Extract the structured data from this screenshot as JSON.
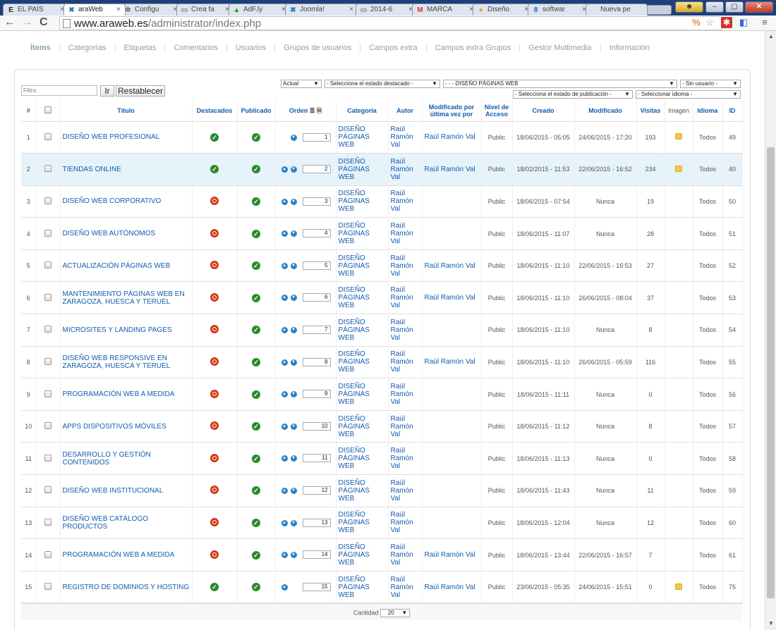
{
  "browser": {
    "tabs": [
      {
        "label": "EL PAÍS",
        "icon": "E"
      },
      {
        "label": "araWeb",
        "icon": "X"
      },
      {
        "label": "Configu",
        "icon": "gear"
      },
      {
        "label": "Crea fa",
        "icon": "page"
      },
      {
        "label": "AdF.ly",
        "icon": "ad"
      },
      {
        "label": "Joomla!",
        "icon": "X"
      },
      {
        "label": "2014-6",
        "icon": "page"
      },
      {
        "label": "MARCA",
        "icon": "M"
      },
      {
        "label": "Diseño",
        "icon": "circle"
      },
      {
        "label": "softwar",
        "icon": "8"
      },
      {
        "label": "Nueva pe",
        "icon": "none"
      }
    ],
    "url_host": "www.araweb.es",
    "url_path": "/administrator/index.php"
  },
  "subnav": [
    "Ítems",
    "Categorías",
    "Etiquetas",
    "Comentarios",
    "Usuarios",
    "Grupos de usuarios",
    "Campos extra",
    "Campos extra Grupos",
    "Gestor Multimedia",
    "Información"
  ],
  "filters": {
    "filter_placeholder": "Filtro:",
    "go_label": "Ir",
    "reset_label": "Restablecer",
    "actual": "Actual",
    "featured_state": "- Selecciona el estado destacado -",
    "category": "- - - DISEÑO PÁGINAS WEB",
    "user": "- Sin usuario -",
    "publish_state": "- Selecciona el estado de publicación -",
    "language": "- Seleccionar idioma -"
  },
  "columns": {
    "num": "#",
    "title": "Título",
    "featured": "Destacados",
    "published": "Publicado",
    "order": "Orden",
    "category": "Categoría",
    "author": "Autor",
    "modified_by": "Modificado por última vez por",
    "access": "Nivel de Acceso",
    "created": "Creado",
    "modified": "Modificado",
    "hits": "Visitas",
    "image": "Imagen",
    "language": "Idioma",
    "id": "ID"
  },
  "rows": [
    {
      "num": "1",
      "title": "DISEÑO WEB PROFESIONAL",
      "featured": true,
      "published": true,
      "up": false,
      "down": true,
      "order": "1",
      "category": "DISEÑO PÁGINAS WEB",
      "author": "Raúl Ramón Val",
      "modified_by": "Raúl Ramón Val",
      "access": "Public",
      "created": "18/06/2015 - 05:05",
      "modified": "24/06/2015 - 17:20",
      "hits": "193",
      "image": true,
      "language": "Todos",
      "id": "49"
    },
    {
      "num": "2",
      "title": "TIENDAS ONLINE",
      "featured": true,
      "published": true,
      "up": true,
      "down": true,
      "order": "2",
      "category": "DISEÑO PÁGINAS WEB",
      "author": "Raúl Ramón Val",
      "modified_by": "Raúl Ramón Val",
      "access": "Public",
      "created": "18/02/2015 - 11:53",
      "modified": "22/06/2015 - 16:52",
      "hits": "234",
      "image": true,
      "language": "Todos",
      "id": "40"
    },
    {
      "num": "3",
      "title": "DISEÑO WEB CORPORATIVO",
      "featured": false,
      "published": true,
      "up": true,
      "down": true,
      "order": "3",
      "category": "DISEÑO PÁGINAS WEB",
      "author": "Raúl Ramón Val",
      "modified_by": "",
      "access": "Public",
      "created": "18/06/2015 - 07:54",
      "modified": "Nunca",
      "hits": "19",
      "image": false,
      "language": "Todos",
      "id": "50"
    },
    {
      "num": "4",
      "title": "DISEÑO WEB AUTÓNOMOS",
      "featured": false,
      "published": true,
      "up": true,
      "down": true,
      "order": "4",
      "category": "DISEÑO PÁGINAS WEB",
      "author": "Raúl Ramón Val",
      "modified_by": "",
      "access": "Public",
      "created": "18/06/2015 - 11:07",
      "modified": "Nunca",
      "hits": "28",
      "image": false,
      "language": "Todos",
      "id": "51"
    },
    {
      "num": "5",
      "title": "ACTUALIZACIÓN PÁGINAS WEB",
      "featured": false,
      "published": true,
      "up": true,
      "down": true,
      "order": "5",
      "category": "DISEÑO PÁGINAS WEB",
      "author": "Raúl Ramón Val",
      "modified_by": "Raúl Ramón Val",
      "access": "Public",
      "created": "18/06/2015 - 11:10",
      "modified": "22/06/2015 - 16:53",
      "hits": "27",
      "image": false,
      "language": "Todos",
      "id": "52"
    },
    {
      "num": "6",
      "title": "MANTENIMIENTO PÁGINAS WEB EN ZARAGOZA, HUESCA Y TERUEL",
      "featured": false,
      "published": true,
      "up": true,
      "down": true,
      "order": "6",
      "category": "DISEÑO PÁGINAS WEB",
      "author": "Raúl Ramón Val",
      "modified_by": "Raúl Ramón Val",
      "access": "Public",
      "created": "18/06/2015 - 11:10",
      "modified": "26/06/2015 - 08:04",
      "hits": "37",
      "image": false,
      "language": "Todos",
      "id": "53"
    },
    {
      "num": "7",
      "title": "MICROSITES Y LANDING PAGES",
      "featured": false,
      "published": true,
      "up": true,
      "down": true,
      "order": "7",
      "category": "DISEÑO PÁGINAS WEB",
      "author": "Raúl Ramón Val",
      "modified_by": "",
      "access": "Public",
      "created": "18/06/2015 - 11:10",
      "modified": "Nunca",
      "hits": "8",
      "image": false,
      "language": "Todos",
      "id": "54"
    },
    {
      "num": "8",
      "title": "DISEÑO WEB RESPONSIVE EN ZARAGOZA, HUESCA Y TERUEL",
      "featured": false,
      "published": true,
      "up": true,
      "down": true,
      "order": "8",
      "category": "DISEÑO PÁGINAS WEB",
      "author": "Raúl Ramón Val",
      "modified_by": "Raúl Ramón Val",
      "access": "Public",
      "created": "18/06/2015 - 11:10",
      "modified": "26/06/2015 - 05:59",
      "hits": "116",
      "image": false,
      "language": "Todos",
      "id": "55"
    },
    {
      "num": "9",
      "title": "PROGRAMACIÓN WEB A MEDIDA",
      "featured": false,
      "published": true,
      "up": true,
      "down": true,
      "order": "9",
      "category": "DISEÑO PÁGINAS WEB",
      "author": "Raúl Ramón Val",
      "modified_by": "",
      "access": "Public",
      "created": "18/06/2015 - 11:11",
      "modified": "Nunca",
      "hits": "0",
      "image": false,
      "language": "Todos",
      "id": "56"
    },
    {
      "num": "10",
      "title": "APPS DISPOSITIVOS MÓVILES",
      "featured": false,
      "published": true,
      "up": true,
      "down": true,
      "order": "10",
      "category": "DISEÑO PÁGINAS WEB",
      "author": "Raúl Ramón Val",
      "modified_by": "",
      "access": "Public",
      "created": "18/06/2015 - 11:12",
      "modified": "Nunca",
      "hits": "8",
      "image": false,
      "language": "Todos",
      "id": "57"
    },
    {
      "num": "11",
      "title": "DESARROLLO Y GESTIÓN CONTENIDOS",
      "featured": false,
      "published": true,
      "up": true,
      "down": true,
      "order": "11",
      "category": "DISEÑO PÁGINAS WEB",
      "author": "Raúl Ramón Val",
      "modified_by": "",
      "access": "Public",
      "created": "18/06/2015 - 11:13",
      "modified": "Nunca",
      "hits": "0",
      "image": false,
      "language": "Todos",
      "id": "58"
    },
    {
      "num": "12",
      "title": "DISEÑO WEB INSTITUCIONAL",
      "featured": false,
      "published": true,
      "up": true,
      "down": true,
      "order": "12",
      "category": "DISEÑO PÁGINAS WEB",
      "author": "Raúl Ramón Val",
      "modified_by": "",
      "access": "Public",
      "created": "18/06/2015 - 11:43",
      "modified": "Nunca",
      "hits": "11",
      "image": false,
      "language": "Todos",
      "id": "59"
    },
    {
      "num": "13",
      "title": "DISEÑO WEB CATÁLOGO PRODUCTOS",
      "featured": false,
      "published": true,
      "up": true,
      "down": true,
      "order": "13",
      "category": "DISEÑO PÁGINAS WEB",
      "author": "Raúl Ramón Val",
      "modified_by": "",
      "access": "Public",
      "created": "18/06/2015 - 12:04",
      "modified": "Nunca",
      "hits": "12",
      "image": false,
      "language": "Todos",
      "id": "60"
    },
    {
      "num": "14",
      "title": "PROGRAMACIÓN WEB A MEDIDA",
      "featured": false,
      "published": true,
      "up": true,
      "down": true,
      "order": "14",
      "category": "DISEÑO PÁGINAS WEB",
      "author": "Raúl Ramón Val",
      "modified_by": "Raúl Ramón Val",
      "access": "Public",
      "created": "18/06/2015 - 13:44",
      "modified": "22/06/2015 - 16:57",
      "hits": "7",
      "image": false,
      "language": "Todos",
      "id": "61"
    },
    {
      "num": "15",
      "title": "REGISTRO DE DOMINIOS Y HOSTING",
      "featured": true,
      "published": true,
      "up": true,
      "down": false,
      "order": "15",
      "category": "DISEÑO PÁGINAS WEB",
      "author": "Raúl Ramón Val",
      "modified_by": "Raúl Ramón Val",
      "access": "Public",
      "created": "23/06/2015 - 05:35",
      "modified": "24/06/2015 - 15:51",
      "hits": "0",
      "image": true,
      "language": "Todos",
      "id": "75"
    }
  ],
  "footer": {
    "label": "Cantidad",
    "value": "20"
  },
  "colors": {
    "link": "#135cae",
    "ok": "#2c8a2c",
    "no": "#d23a13",
    "highlight": "#e6f3fb"
  }
}
